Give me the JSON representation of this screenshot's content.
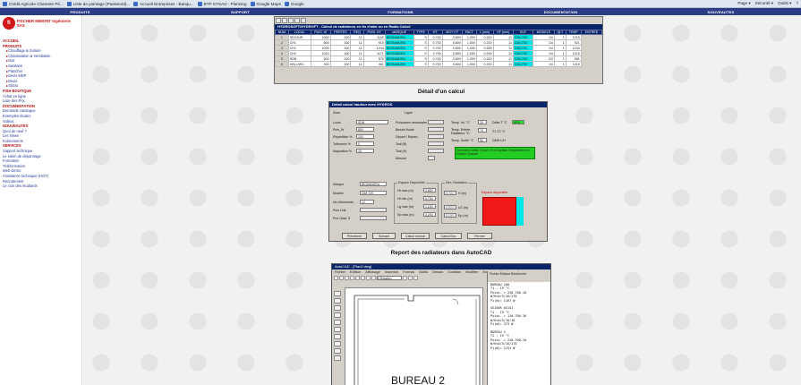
{
  "browser": {
    "favorites": [
      "Crédit Agricole Charente Pé...",
      "Liste de pointage (Password)...",
      "Accueil Entreprises - Banqu...",
      "BTP SYSAO - Planning",
      "Google Maps",
      "Google"
    ],
    "tools": [
      "Page ▾",
      "Sécurité ▾",
      "Outils ▾",
      "?"
    ]
  },
  "nav": [
    "PRODUITS",
    "SUPPORT",
    "FORMATIONS",
    "DOCUMENTATION",
    "NOUVEAUTES"
  ],
  "sidebar": {
    "logo_badge": "fi",
    "logo_text": "FISCHER MIMONT Ingénierie SAS",
    "items": [
      {
        "label": "ACCUEIL",
        "kind": "h"
      },
      {
        "label": "PRODUITS",
        "kind": "h"
      },
      {
        "label": "Chauffage & Solaire",
        "kind": "s"
      },
      {
        "label": "Climatisation & Ventilation",
        "kind": "s"
      },
      {
        "label": "Gaz",
        "kind": "s"
      },
      {
        "label": "Sanitaire",
        "kind": "s"
      },
      {
        "label": "Plancher",
        "kind": "s"
      },
      {
        "label": "Devis MEP",
        "kind": "s"
      },
      {
        "label": "Devis",
        "kind": "s"
      },
      {
        "label": "Strato",
        "kind": "s"
      },
      {
        "label": "FISH BOUTIQUE",
        "kind": "h"
      },
      {
        "label": "Achat en ligne",
        "kind": "n"
      },
      {
        "label": "Liste des Prix",
        "kind": "n"
      },
      {
        "label": "DOCUMENTATION",
        "kind": "h"
      },
      {
        "label": "Demande catalogue",
        "kind": "n"
      },
      {
        "label": "Exemples études",
        "kind": "n"
      },
      {
        "label": "Vidéos",
        "kind": "n"
      },
      {
        "label": "NOUVEAUTES",
        "kind": "h"
      },
      {
        "label": "Quoi de neuf ?",
        "kind": "n"
      },
      {
        "label": "Les News",
        "kind": "n"
      },
      {
        "label": "Evènements",
        "kind": "n"
      },
      {
        "label": "SERVICES",
        "kind": "h"
      },
      {
        "label": "Support technique",
        "kind": "n"
      },
      {
        "label": "Le salon de dépannage",
        "kind": "n"
      },
      {
        "label": "Formation",
        "kind": "n"
      },
      {
        "label": "Téléformation",
        "kind": "n"
      },
      {
        "label": "Web Démo",
        "kind": "n"
      },
      {
        "label": "Assistance technique (HOT)",
        "kind": "n"
      },
      {
        "label": "Recrutement",
        "kind": "n"
      },
      {
        "label": "Le coin des étudiants",
        "kind": "n"
      }
    ]
  },
  "table_window": {
    "title": "HYDROSOFT/HYDROFT - Calcul de radiateurs en fin d'aide ou en Radia Calcul",
    "headers": [
      "NUM",
      "LOCAL",
      "PUIS. W",
      "PERTES",
      "REQ",
      "PUIS. HY",
      "MARQUE",
      "TYPE",
      "HT",
      "MOY HT",
      "FACT",
      "L (mm)",
      "HT (mm)",
      "ELE",
      "MODELE",
      "QLT",
      "TEMP",
      "ENTREE"
    ],
    "rows": [
      [
        "1",
        "SÉJOUR",
        "1000",
        "100",
        "11",
        "1160",
        "BIGSANDRA",
        "S",
        "0.700",
        "0.800",
        "1.000",
        "0.200",
        "11",
        "DIM-700",
        "1/4",
        "1",
        "1215"
      ],
      [
        "2",
        "CH1",
        "800",
        "100",
        "11",
        "915",
        "BIGSANDRA",
        "S",
        "0.700",
        "0.800",
        "1.000",
        "0.200",
        "11",
        "DIM-700",
        "1/4",
        "1",
        "921"
      ],
      [
        "3",
        "CH1",
        "1000",
        "100",
        "11",
        "1244",
        "BIGSANDRA",
        "S",
        "0.700",
        "0.800",
        "1.000",
        "0.200",
        "11",
        "DIM-700",
        "1/4",
        "1",
        "1244"
      ],
      [
        "4",
        "CH2",
        "1020",
        "100",
        "11",
        "1171",
        "BIGSANDRA",
        "S",
        "0.700",
        "0.800",
        "1.000",
        "0.200",
        "11",
        "DIM-700",
        "1/4",
        "1",
        "1215"
      ],
      [
        "5",
        "SDB",
        "500",
        "100",
        "11",
        "575",
        "BIGSANDRA",
        "S",
        "0.700",
        "0.800",
        "1.000",
        "0.200",
        "11",
        "DIM-700",
        "2/2",
        "1",
        "581"
      ],
      [
        "6",
        "HALL/WC",
        "400",
        "100",
        "11",
        "461",
        "BIGSANDRA",
        "S",
        "0.700",
        "0.800",
        "1.000",
        "0.200",
        "11",
        "DIM-700",
        "1/4",
        "1",
        "1215"
      ]
    ]
  },
  "heading_detail": "Détail d'un calcul",
  "dialog": {
    "title": "Détail calcul hauteur avec HYDROS",
    "tab_zone": "Zone",
    "tab_ligne": "Ligne",
    "labels": {
      "local": "Local",
      "puis_w": "Puis_W",
      "repartition": "Répartition %",
      "tolerance": "Tolérance %",
      "majoration": "Majoration %",
      "puissance": "Puissance nécessaire",
      "besoin": "Besoin fluide",
      "depart": "Départ / Répart.",
      "tcal_b": "Tcal (B)",
      "tcal_h": "Tcal (H)",
      "mesuré": "Mesuré",
      "temp_int": "Temp. Int. °C",
      "temp_entree": "Temp. Entrée Radiateur °C",
      "temp_sortie": "Temp. Sortie °C",
      "delta_t": "Delta T °C",
      "t1_t2": "T1-T2 °C",
      "dmh": "DMH L/H",
      "marque": "Marque",
      "modele": "Modèle",
      "nb_elements": "Nb d'éléments",
      "puis_unit": "Puis Unit",
      "prix_grad": "Prix Grad. €",
      "encombrement": "Espace Disponible",
      "ht_max": "Ht max (m)",
      "ht_min": "Ht min (m)",
      "lg_max": "Lg max (m)",
      "ep_max": "Ep max (m)",
      "dim_radiateur": "Dim. Radiateur",
      "h_m": "H (m)",
      "lg_m": "LG (m)",
      "ep_m": "Ep (m)"
    },
    "values": {
      "local": "SDB",
      "puis_w": "800",
      "repartition": "100",
      "tolerance": "0",
      "majoration": "15",
      "temp_int": "20",
      "temp_entree": "70",
      "temp_sortie": "50",
      "delta_t": "40.0",
      "marque": "BIGSANDRA",
      "modele": "DIM-720",
      "nb_elements": "12",
      "ht_max": "0.800",
      "ht_min": "0.700",
      "lg_max": "1.100",
      "ep_max": "0.200",
      "dim_h": "0.720",
      "dim_lg": "0.870",
      "dim_ep": "0.100"
    },
    "green_note": "Correction Delta T pour 1.5 m Surface Température en Courbe Chaude",
    "red_note_label": "Espace disponible",
    "buttons": [
      "Précédent",
      "Suivant",
      "Calcul normal",
      "Calcul Ecc",
      "Fermer"
    ]
  },
  "heading_autocad": "Report des radiateurs dans AutoCAD",
  "cad": {
    "title": "AutoCAD - [Plan2.dwg]",
    "menu": [
      "Fichier",
      "Edition",
      "Affichage",
      "Insertion",
      "Format",
      "Outils",
      "Dessin",
      "Cotation",
      "Modifier",
      "Express",
      "Fenêtre",
      "?"
    ],
    "layer": "0 Rotation",
    "note_menu": "Fichier   Edition   Recherche",
    "note_text": "BUREAU 100\nT1 - 19 °C\nPuiss. = 220-700-10\nW/H=0/5/16/170\nPi(W)= 1167 W\n\nSEJOUR 04141\nT1 - 19 °C\nPuiss. = 110-700-16\nW/H=0/5/16/16\nPi(W)= 373 W\n\nBUREAU 2\nT1 - 19 °C\nPuiss. = 220-700-10\nW/H=0/5/16/170\nPi(W)= 1251 W",
    "label": "BUREAU 2"
  }
}
